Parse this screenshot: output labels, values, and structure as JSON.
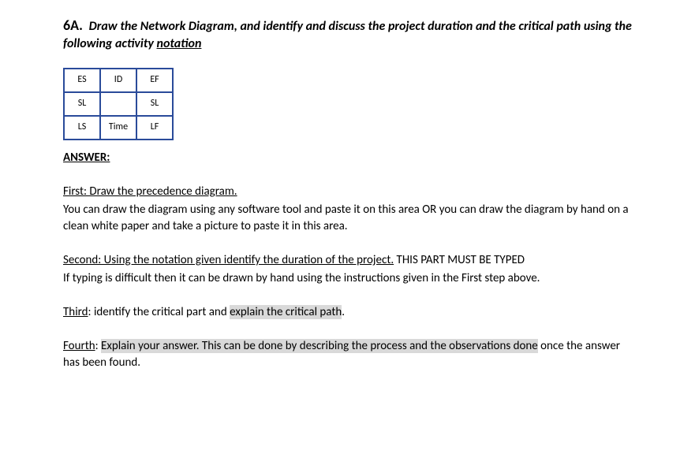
{
  "question": {
    "number": "6A.",
    "text_part1": "Draw the Network Diagram, and identify and discuss the project duration and the critical path using the following activity ",
    "text_notation": "notation"
  },
  "notation": {
    "r1c1": "ES",
    "r1c2": "ID",
    "r1c3": "EF",
    "r2c1": "SL",
    "r2c2": "",
    "r2c3": "SL",
    "r3c1": "LS",
    "r3c2": "Time",
    "r3c3": "LF"
  },
  "answer_label": "ANSWER:",
  "steps": {
    "first": {
      "title": "First: Draw the precedence diagram.",
      "body": "You can draw the diagram using any software tool and paste it on this area OR you can draw the diagram by hand on a clean white paper and take a picture to paste it in this area."
    },
    "second": {
      "title": "Second: Using the notation given identify the duration of the project.",
      "title_suffix": " THIS PART MUST BE TYPED",
      "body": "If typing is difficult then it can be drawn by hand using the instructions given in the First step above."
    },
    "third": {
      "prefix": "Third",
      "mid": ": identify the critical part and ",
      "highlight": "explain the critical path",
      "suffix": "."
    },
    "fourth": {
      "prefix": "Fourth",
      "mid": ":  ",
      "highlight": "Explain your answer.  This can be done by describing the process and the observations done",
      "suffix": " once the answer has been found."
    }
  }
}
